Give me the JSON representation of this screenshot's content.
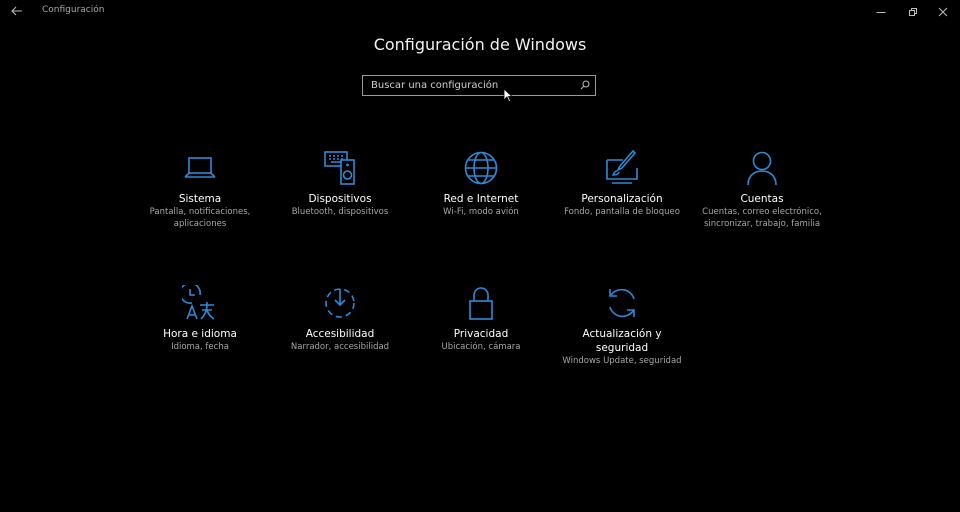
{
  "window": {
    "title": "Configuración",
    "accent": "#2d8bd6"
  },
  "header": {
    "title": "Configuración de Windows"
  },
  "search": {
    "placeholder": "Buscar una configuración"
  },
  "tiles": [
    {
      "title": "Sistema",
      "desc": "Pantalla, notificaciones, aplicaciones",
      "icon": "laptop-icon"
    },
    {
      "title": "Dispositivos",
      "desc": "Bluetooth, dispositivos",
      "icon": "devices-icon"
    },
    {
      "title": "Red e Internet",
      "desc": "Wi-Fi, modo avión",
      "icon": "globe-icon"
    },
    {
      "title": "Personalización",
      "desc": "Fondo, pantalla de bloqueo",
      "icon": "personalization-icon"
    },
    {
      "title": "Cuentas",
      "desc": "Cuentas, correo electrónico, sincronizar, trabajo, familia",
      "icon": "person-icon"
    },
    {
      "title": "Hora e idioma",
      "desc": "Idioma, fecha",
      "icon": "time-language-icon"
    },
    {
      "title": "Accesibilidad",
      "desc": "Narrador, accesibilidad",
      "icon": "accessibility-icon"
    },
    {
      "title": "Privacidad",
      "desc": "Ubicación, cámara",
      "icon": "lock-icon"
    },
    {
      "title": "Actualización y seguridad",
      "desc": "Windows Update, seguridad",
      "icon": "sync-icon"
    }
  ]
}
